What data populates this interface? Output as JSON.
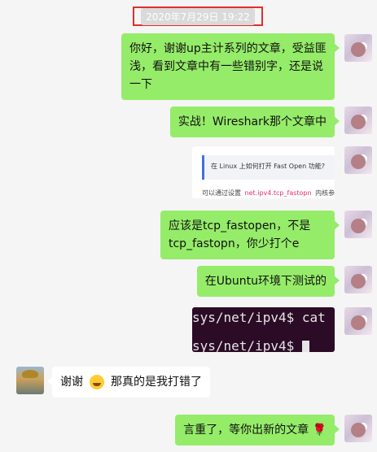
{
  "timestamp": "2020年7月29日 19:22",
  "messages": [
    {
      "text": "你好，谢谢up主计系列的文章，受益匪浅，看到文章中有一些错别字，还是说一下"
    },
    {
      "text": "实战！Wireshark那个文章中"
    },
    {
      "card_title": "在 Linux 上如何打开 Fast Open 功能?",
      "card_footer_prefix": "可以通过设置",
      "card_footer_code": "net.ipv4.tcp_fastopn",
      "card_footer_suffix": "内核参数,"
    },
    {
      "text": "应该是tcp_fastopen，不是tcp_fastopn，你少打个e"
    },
    {
      "text": "在Ubuntu环境下测试的"
    },
    {
      "term_line1": "sys/net/ipv4$ cat",
      "term_line2": "sys/net/ipv4$ "
    },
    {
      "text_before_emoji": "谢谢",
      "text_after_emoji": "那真的是我打错了"
    },
    {
      "text": "言重了，等你出新的文章 🌹"
    }
  ],
  "colors": {
    "my_bubble": "#95ec69",
    "their_bubble": "#ffffff",
    "background": "#f5f5f5",
    "highlight_box": "#e0302a"
  }
}
